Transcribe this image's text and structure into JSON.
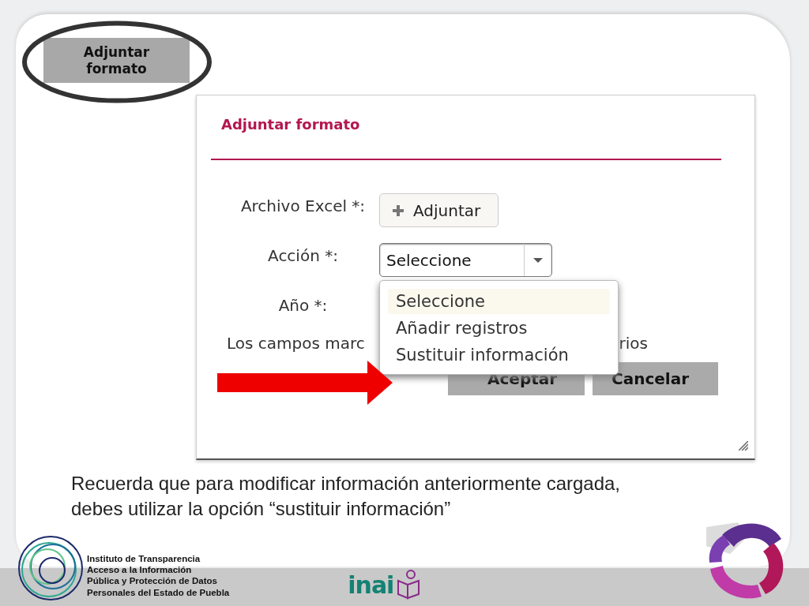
{
  "highlight_button": {
    "label": "Adjuntar formato"
  },
  "dialog": {
    "title": "Adjuntar formato",
    "fields": [
      {
        "kind": "button",
        "label": "Archivo Excel *:",
        "value": "Adjuntar"
      },
      {
        "kind": "select",
        "label": "Acción *:",
        "value": "Seleccione",
        "expanded": true,
        "options": [
          {
            "label": "Seleccione",
            "selected": true
          },
          {
            "label": "Añadir registros",
            "selected": false
          },
          {
            "label": "Sustituir información",
            "selected": false
          }
        ]
      },
      {
        "kind": "empty",
        "label": "Año *:"
      }
    ],
    "note_parts": [
      "Los campos marc",
      "rios"
    ],
    "buttons": [
      "Aceptar",
      "Cancelar"
    ]
  },
  "caption": "Recuerda que para modificar información anteriormente cargada, debes utilizar la opción “sustituir información”",
  "footer": {
    "institute_lines": [
      "Instituto de Transparencia",
      "Acceso a la Información",
      "Pública y Protección de Datos",
      "Personales del Estado de Puebla"
    ],
    "center_logo": "inai"
  }
}
